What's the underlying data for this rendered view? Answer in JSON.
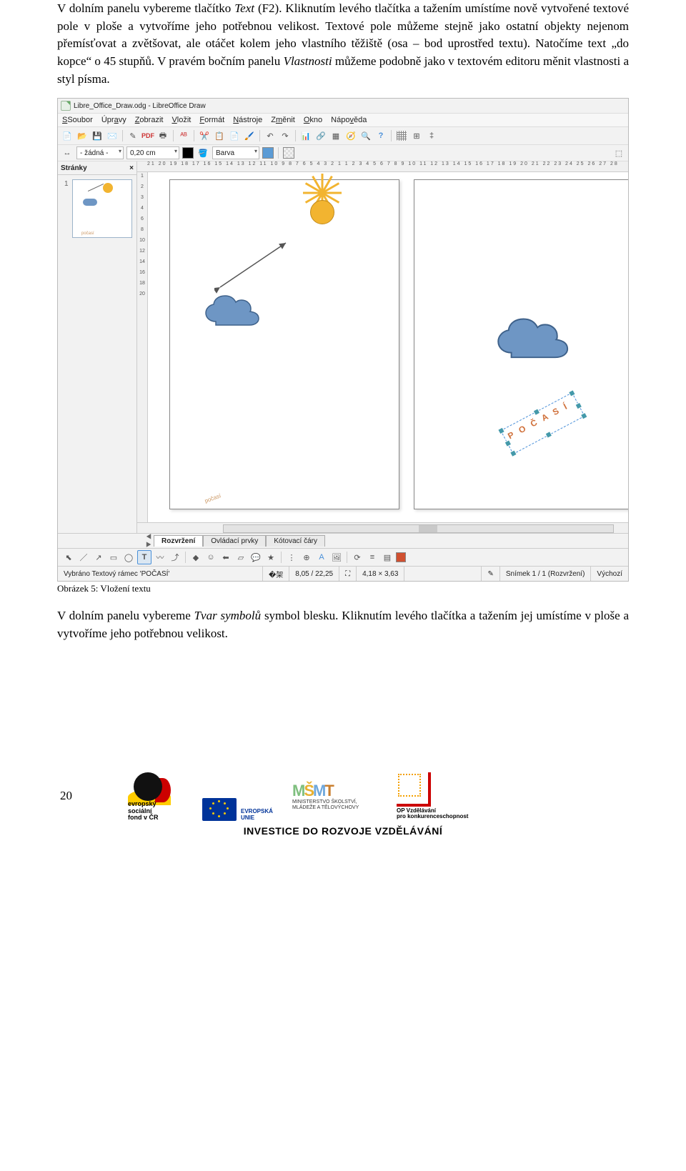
{
  "para1_a": "V dolním panelu vybereme tlačítko ",
  "para1_b": "Text",
  "para1_c": " (F2). Kliknutím levého tlačítka a tažením umístíme nově vytvořené textové pole v ploše a vytvoříme jeho potřebnou velikost. Textové pole můžeme stejně jako ostatní objekty nejenom přemísťovat a zvětšovat, ale otáčet kolem jeho vlastního těžiště (osa – bod uprostřed textu). Natočíme text „do kopce“ o 45 stupňů. V pravém bočním panelu ",
  "para1_d": "Vlastnosti",
  "para1_e": " můžeme podobně jako v textovém editoru měnit vlastnosti a styl písma.",
  "caption": "Obrázek 5: Vložení textu",
  "para2_a": "V dolním panelu vybereme ",
  "para2_b": "Tvar symbolů",
  "para2_c": " symbol blesku. Kliknutím levého tlačítka a tažením jej umístíme v ploše a vytvoříme jeho potřebnou velikost.",
  "page_number": "20",
  "invest_line": "INVESTICE DO ROZVOJE VZDĚLÁVÁNÍ",
  "app": {
    "title": "Libre_Office_Draw.odg - LibreOffice Draw",
    "menu": [
      "Soubor",
      "Úpravy",
      "Zobrazit",
      "Vložit",
      "Formát",
      "Nástroje",
      "Změnit",
      "Okno",
      "Nápověda"
    ],
    "line_style": "- žádná -",
    "line_width": "0,20 cm",
    "fill_label": "Barva",
    "sidebar_title": "Stránky",
    "sidebar_close": "×",
    "thumb_num": "1",
    "ruler_h": "21 20 19 18 17 16 15 14 13 12 11 10  9  8  7  6  5  4  3  2  1     1  2  3  4  5  6  7  8  9 10 11 12 13 14 15 16 17 18 19 20 21 22 23 24 25 26 27 28",
    "ruler_v": [
      "1",
      "2",
      "3",
      "4",
      "6",
      "8",
      "10",
      "12",
      "14",
      "16",
      "18",
      "20"
    ],
    "thumb_word": "počasí",
    "rot_word": "P O Č A S Í",
    "tabs": {
      "arrows": "⏮ ◀ ▶ ⏭",
      "a": "Rozvržení",
      "b": "Ovládací prvky",
      "c": "Kótovací čáry"
    },
    "status": {
      "sel": "Vybráno Textový rámec 'POČASÍ'",
      "pos": "8,05 / 22,25",
      "size": "4,18 × 3,63",
      "slide": "Snímek 1 / 1 (Rozvržení)",
      "mode": "Výchozí"
    }
  },
  "esf": {
    "l1": "evropský",
    "l2": "sociální",
    "l3": "fond v ČR"
  },
  "eu": {
    "l1": "EVROPSKÁ UNIE"
  },
  "msmt": {
    "l1": "MINISTERSTVO ŠKOLSTVÍ,",
    "l2": "MLÁDEŽE A TĚLOVÝCHOVY"
  },
  "opvk": {
    "l1": "OP Vzdělávání",
    "l2": "pro konkurenceschopnost"
  }
}
